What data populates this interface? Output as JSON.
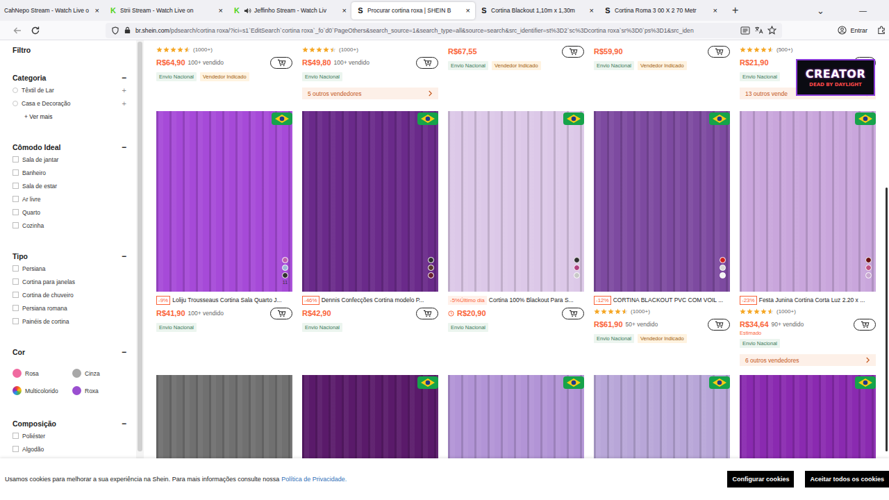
{
  "browser": {
    "tabs": [
      {
        "icon": "",
        "icon_color": "#53d31a",
        "label": "CahNepo Stream - Watch Live o",
        "close": "×",
        "selected": false,
        "audio": false
      },
      {
        "icon": "K",
        "icon_color": "#53d31a",
        "label": "Strii Stream - Watch Live on",
        "close": "×",
        "selected": false,
        "audio": false
      },
      {
        "icon": "K",
        "icon_color": "#53d31a",
        "label": "Jeffinho Stream - Watch Liv",
        "close": "×",
        "selected": false,
        "audio": true
      },
      {
        "icon": "S",
        "icon_color": "#111111",
        "label": "Procurar cortina roxa | SHEIN B",
        "close": "×",
        "selected": true,
        "audio": false
      },
      {
        "icon": "S",
        "icon_color": "#111111",
        "label": "Cortina Blackout 1,10m x 1,30m",
        "close": "×",
        "selected": false,
        "audio": false
      },
      {
        "icon": "S",
        "icon_color": "#111111",
        "label": "Cortina Roma 3 00 X 2 70 Metr",
        "close": "×",
        "selected": false,
        "audio": false
      }
    ],
    "new_tab": "+",
    "tab_list": "⌄",
    "minimize": "—",
    "url_host": "br.shein.com",
    "url_path": "/pdsearch/cortina roxa/?ici=s1`EditSearch`cortina roxa`_fo`d0`PageOthers&search_source=1&search_type=all&source=search&src_identifier=st%3D2`sc%3Dcortina roxa`sr%3D0`ps%3D1&src_iden",
    "signin": "Entrar"
  },
  "sidebar": {
    "title": "Filtro",
    "sections": [
      {
        "title": "Categoria",
        "toggle": "−",
        "items": [
          {
            "kind": "radio",
            "label": "Têxtil de Lar",
            "expand": "+",
            "checked": false
          },
          {
            "kind": "radio",
            "label": "Casa e Decoração",
            "expand": "+",
            "checked": false
          },
          {
            "kind": "link",
            "label": "+ Ver mais"
          }
        ]
      },
      {
        "title": "Cômodo Ideal",
        "toggle": "−",
        "items": [
          {
            "kind": "checkbox",
            "label": "Sala de jantar",
            "checked": false
          },
          {
            "kind": "checkbox",
            "label": "Banheiro",
            "checked": false
          },
          {
            "kind": "checkbox",
            "label": "Sala de estar",
            "checked": false
          },
          {
            "kind": "checkbox",
            "label": "Ar livre",
            "checked": false
          },
          {
            "kind": "checkbox",
            "label": "Quarto",
            "checked": false
          },
          {
            "kind": "checkbox",
            "label": "Cozinha",
            "checked": false
          }
        ]
      },
      {
        "title": "Tipo",
        "toggle": "−",
        "items": [
          {
            "kind": "checkbox",
            "label": "Persiana",
            "checked": false
          },
          {
            "kind": "checkbox",
            "label": "Cortina para janelas",
            "checked": false
          },
          {
            "kind": "checkbox",
            "label": "Cortina de chuveiro",
            "checked": false
          },
          {
            "kind": "checkbox",
            "label": "Persiana romana",
            "checked": false
          },
          {
            "kind": "checkbox",
            "label": "Painéis de cortina",
            "checked": false
          }
        ]
      },
      {
        "title": "Cor",
        "toggle": "−",
        "items": [
          {
            "kind": "color",
            "label": "Rosa",
            "color": "#f06aa0",
            "checked": false
          },
          {
            "kind": "color",
            "label": "Cinza",
            "color": "#a8a8a8",
            "checked": false
          },
          {
            "kind": "multicolor",
            "label": "Multicolorido",
            "color": "#e8a040",
            "checked": false
          },
          {
            "kind": "color",
            "label": "Roxa",
            "color": "#9a4fd0",
            "checked": false
          }
        ]
      },
      {
        "title": "Composição",
        "toggle": "−",
        "items": [
          {
            "kind": "checkbox",
            "label": "Poliéster",
            "checked": false
          },
          {
            "kind": "checkbox",
            "label": "Algodão",
            "checked": false
          }
        ]
      }
    ]
  },
  "top_row": [
    {
      "stars": 4.5,
      "reviews": "(1000+)",
      "price": "R$64,90",
      "sold": "100+ vendido",
      "tags": [
        {
          "label": "Envio Nacional",
          "kind": "shipping"
        },
        {
          "label": "Vendedor Indicado",
          "kind": "seller"
        }
      ]
    },
    {
      "stars": 4.5,
      "reviews": "(1000+)",
      "price": "R$49,80",
      "sold": "100+ vendido",
      "tags": [
        {
          "label": "Envio Nacional",
          "kind": "shipping"
        }
      ],
      "sellers": "5 outros vendedores"
    },
    {
      "price": "R$67,55",
      "tags": [
        {
          "label": "Envio Nacional",
          "kind": "shipping"
        },
        {
          "label": "Vendedor Indicado",
          "kind": "seller"
        }
      ]
    },
    {
      "price": "R$59,90",
      "tags": [
        {
          "label": "Envio Nacional",
          "kind": "shipping"
        },
        {
          "label": "Vendedor Indicado",
          "kind": "seller"
        }
      ]
    },
    {
      "stars": 4.5,
      "reviews": "(500+)",
      "price": "R$21,90",
      "tags": [
        {
          "label": "Envio Nacional",
          "kind": "shipping"
        }
      ],
      "sellers": "13 outros vende"
    }
  ],
  "middle_row": [
    {
      "image_color": "#a64ad8",
      "badge": true,
      "swatches": [
        "#c060b0",
        "#a0b8d8",
        "#303030"
      ],
      "swatch_count": "11",
      "discount": "-9%",
      "discount_kind": "plain",
      "title": "Loliju Trousseaus Cortina Sala Quarto J...",
      "price": "R$41,90",
      "sold": "100+ vendido",
      "tags": [
        {
          "label": "Envio Nacional",
          "kind": "shipping"
        }
      ]
    },
    {
      "image_color": "#6a2a8a",
      "badge": true,
      "swatches": [
        "#303030",
        "#5a3a30",
        "#6a2030"
      ],
      "discount": "-46%",
      "discount_kind": "plain",
      "title": "Dennis Confecções Cortina modelo P...",
      "price": "R$42,90",
      "tags": [
        {
          "label": "Envio Nacional",
          "kind": "shipping"
        }
      ]
    },
    {
      "image_color": "#dcc8e8",
      "badge": true,
      "swatches": [
        "#303030",
        "#b04080",
        "#c8c8c8"
      ],
      "discount": "-5%Último dia",
      "discount_kind": "deal",
      "title": "Cortina 100% Blackout Para S...",
      "clock": true,
      "price": "R$20,90",
      "tags": [
        {
          "label": "Envio Nacional",
          "kind": "shipping"
        }
      ]
    },
    {
      "image_color": "#7d4aa0",
      "badge": true,
      "swatches": [
        "#d02020",
        "#d8d8d8",
        "#f4f4f4"
      ],
      "discount": "-12%",
      "discount_kind": "plain",
      "title": "CORTINA BLACKOUT PVC COM VOIL ...",
      "stars": 4.5,
      "reviews": "(1000+)",
      "price": "R$61,90",
      "sold": "50+ vendido",
      "tags": [
        {
          "label": "Envio Nacional",
          "kind": "shipping"
        },
        {
          "label": "Vendedor Indicado",
          "kind": "seller"
        }
      ]
    },
    {
      "image_color": "#c9a6dc",
      "badge": true,
      "swatches": [
        "#6a1010",
        "#c05080",
        "#c8a8d0"
      ],
      "discount": "-23%",
      "discount_kind": "plain",
      "title": "Festa Junina Cortina Corta Luz 2.20 x ...",
      "stars": 4.5,
      "reviews": "(1000+)",
      "price": "R$34,64",
      "sold": "90+ vendido",
      "estimate": "Estimado",
      "tags": [
        {
          "label": "Envio Nacional",
          "kind": "shipping"
        }
      ],
      "sellers": "6 outros vendedores"
    }
  ],
  "bottom_row": [
    {
      "image_color": "#707070",
      "badge": false
    },
    {
      "image_color": "#5a1a6a",
      "badge": true
    },
    {
      "image_color": "#b294d6",
      "badge": true
    },
    {
      "image_color": "#b8a6d8",
      "badge": true
    },
    {
      "image_color": "#8a2ab0",
      "badge": true
    }
  ],
  "overlay": {
    "title": "CREATOR",
    "subtitle": "DEAD BY DAYLIGHT"
  },
  "cookies": {
    "text": "Usamos cookies para melhorar a sua experiência na Shein. Para mais informações consulte nossa",
    "link": "Política de Privacidade.",
    "buttons": [
      "Configurar cookies",
      "Aceitar todos os cookies"
    ]
  }
}
